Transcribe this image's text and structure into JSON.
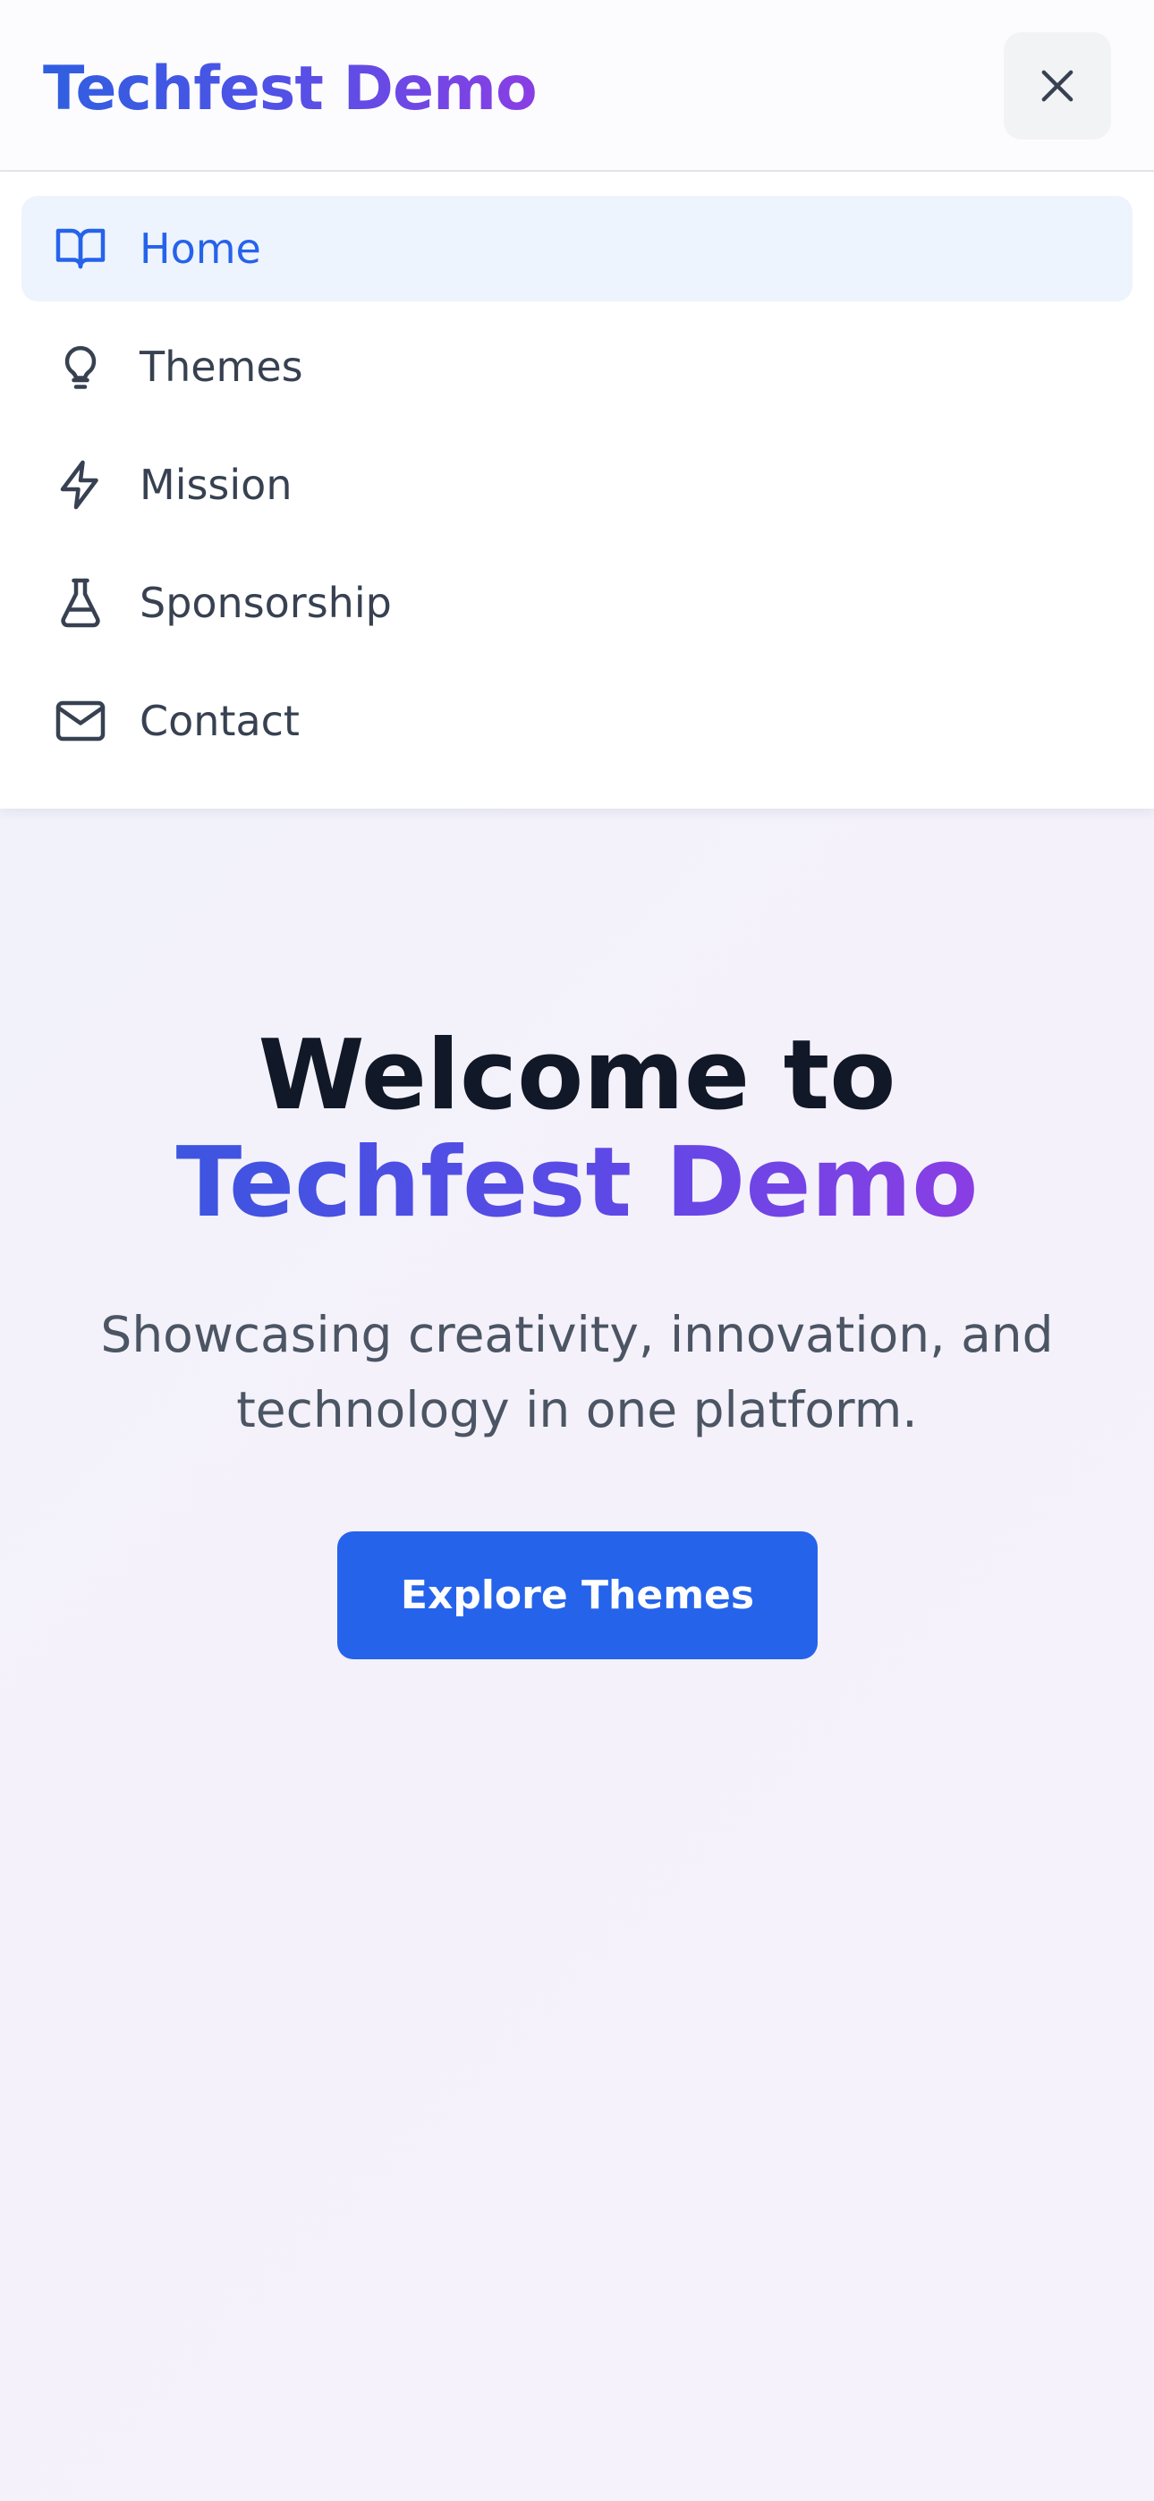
{
  "header": {
    "brand": "Techfest Demo",
    "close_icon": "close-icon"
  },
  "nav": {
    "items": [
      {
        "label": "Home",
        "icon": "book-open-icon",
        "active": true
      },
      {
        "label": "Themes",
        "icon": "lightbulb-icon",
        "active": false
      },
      {
        "label": "Mission",
        "icon": "lightning-bolt-icon",
        "active": false
      },
      {
        "label": "Sponsorship",
        "icon": "flask-icon",
        "active": false
      },
      {
        "label": "Contact",
        "icon": "mail-icon",
        "active": false
      }
    ]
  },
  "hero": {
    "title_line1": "Welcome to",
    "title_line2": "Techfest Demo",
    "subtitle": "Showcasing creativity, innovation, and technology in one platform.",
    "cta_label": "Explore Themes"
  },
  "colors": {
    "accent": "#2563eb",
    "gradient_start": "#2f5fe0",
    "gradient_end": "#8a3ee4",
    "active_bg": "#eef4fd",
    "heading": "#111827",
    "text": "#374151"
  }
}
